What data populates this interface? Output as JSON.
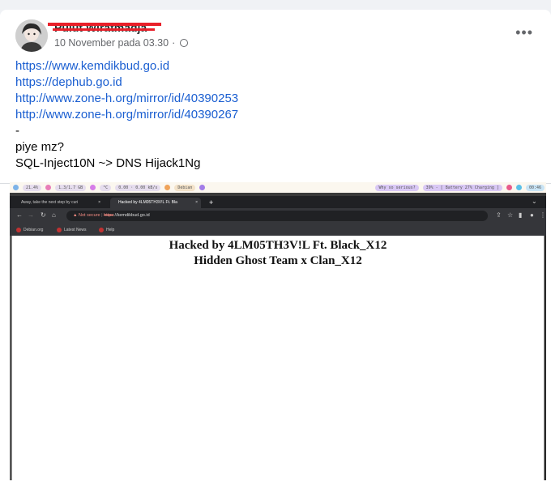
{
  "post": {
    "author": "Pulut Wiratmadja",
    "timestamp": "10 November pada 03.30",
    "separator": "·",
    "privacy_icon": "globe-icon",
    "more_label": "•••",
    "lines": [
      {
        "text": "https://www.kemdikbud.go.id",
        "type": "link"
      },
      {
        "text": "https://dephub.go.id",
        "type": "link"
      },
      {
        "text": "http://www.zone-h.org/mirror/id/40390253",
        "type": "link"
      },
      {
        "text": "http://www.zone-h.org/mirror/id/40390267",
        "type": "link"
      },
      {
        "text": "-",
        "type": "text"
      },
      {
        "text": "piye mz?",
        "type": "text"
      },
      {
        "text": "SQL-Inject10N ~> DNS Hijack1Ng",
        "type": "text"
      }
    ]
  },
  "screenshot": {
    "sysbar": {
      "items": [
        "21.4%",
        "1.3/1.7 GB",
        "°C",
        "0.00 · 0.00 kB/s",
        "Debian",
        "Why so serious?",
        "39% - [ Battery 27% Charging ]",
        "00:46"
      ]
    },
    "tabs": [
      {
        "label": "Away, take the next step by curi",
        "close": "×"
      },
      {
        "label": "Hacked by 4LM05TH3V!L Ft. Bla",
        "close": "×"
      }
    ],
    "new_tab": "+",
    "omnibox": {
      "not_secure": "Not secure",
      "scheme": "https",
      "host": "://kemdikbud.go.id"
    },
    "bookmarks": [
      "Debian.org",
      "Latest News",
      "Help"
    ],
    "deface": {
      "line1": "Hacked by 4LM05TH3V!L Ft. Black_X12",
      "line2": "Hidden Ghost Team x Clan_X12"
    }
  }
}
